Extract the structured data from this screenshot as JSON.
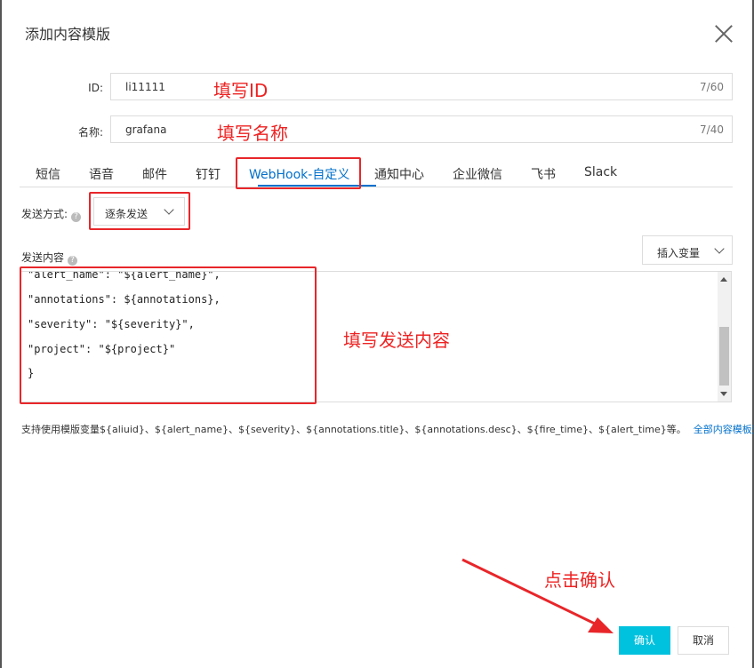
{
  "dialog": {
    "title": "添加内容模版"
  },
  "id_field": {
    "label": "ID:",
    "value": "li11111",
    "counter": "7/60"
  },
  "name_field": {
    "label": "名称:",
    "value": "grafana",
    "counter": "7/40"
  },
  "tabs": [
    "短信",
    "语音",
    "邮件",
    "钉钉",
    "WebHook-自定义",
    "通知中心",
    "企业微信",
    "飞书",
    "Slack"
  ],
  "active_tab": "WebHook-自定义",
  "send_method": {
    "label": "发送方式:",
    "value": "逐条发送"
  },
  "send_content": {
    "label": "发送内容",
    "insert_button": "插入变量"
  },
  "editor_lines": [
    "\"alert_name\": \"${alert_name}\",",
    "\"annotations\": ${annotations},",
    "\"severity\": \"${severity}\",",
    "\"project\": \"${project}\"",
    "}"
  ],
  "hint": {
    "text": "支持使用模版变量${aliuid}、${alert_name}、${severity}、${annotations.title}、${annotations.desc}、${fire_time}、${alert_time}等。",
    "link": "全部内容模板变量"
  },
  "annotations": {
    "fill_id": "填写ID",
    "fill_name": "填写名称",
    "fill_content": "填写发送内容",
    "click_confirm": "点击确认"
  },
  "buttons": {
    "confirm": "确认",
    "cancel": "取消"
  },
  "colors": {
    "accent": "#0070cc",
    "confirm_bg": "#00c1de",
    "annotation_red": "#e8262a"
  }
}
